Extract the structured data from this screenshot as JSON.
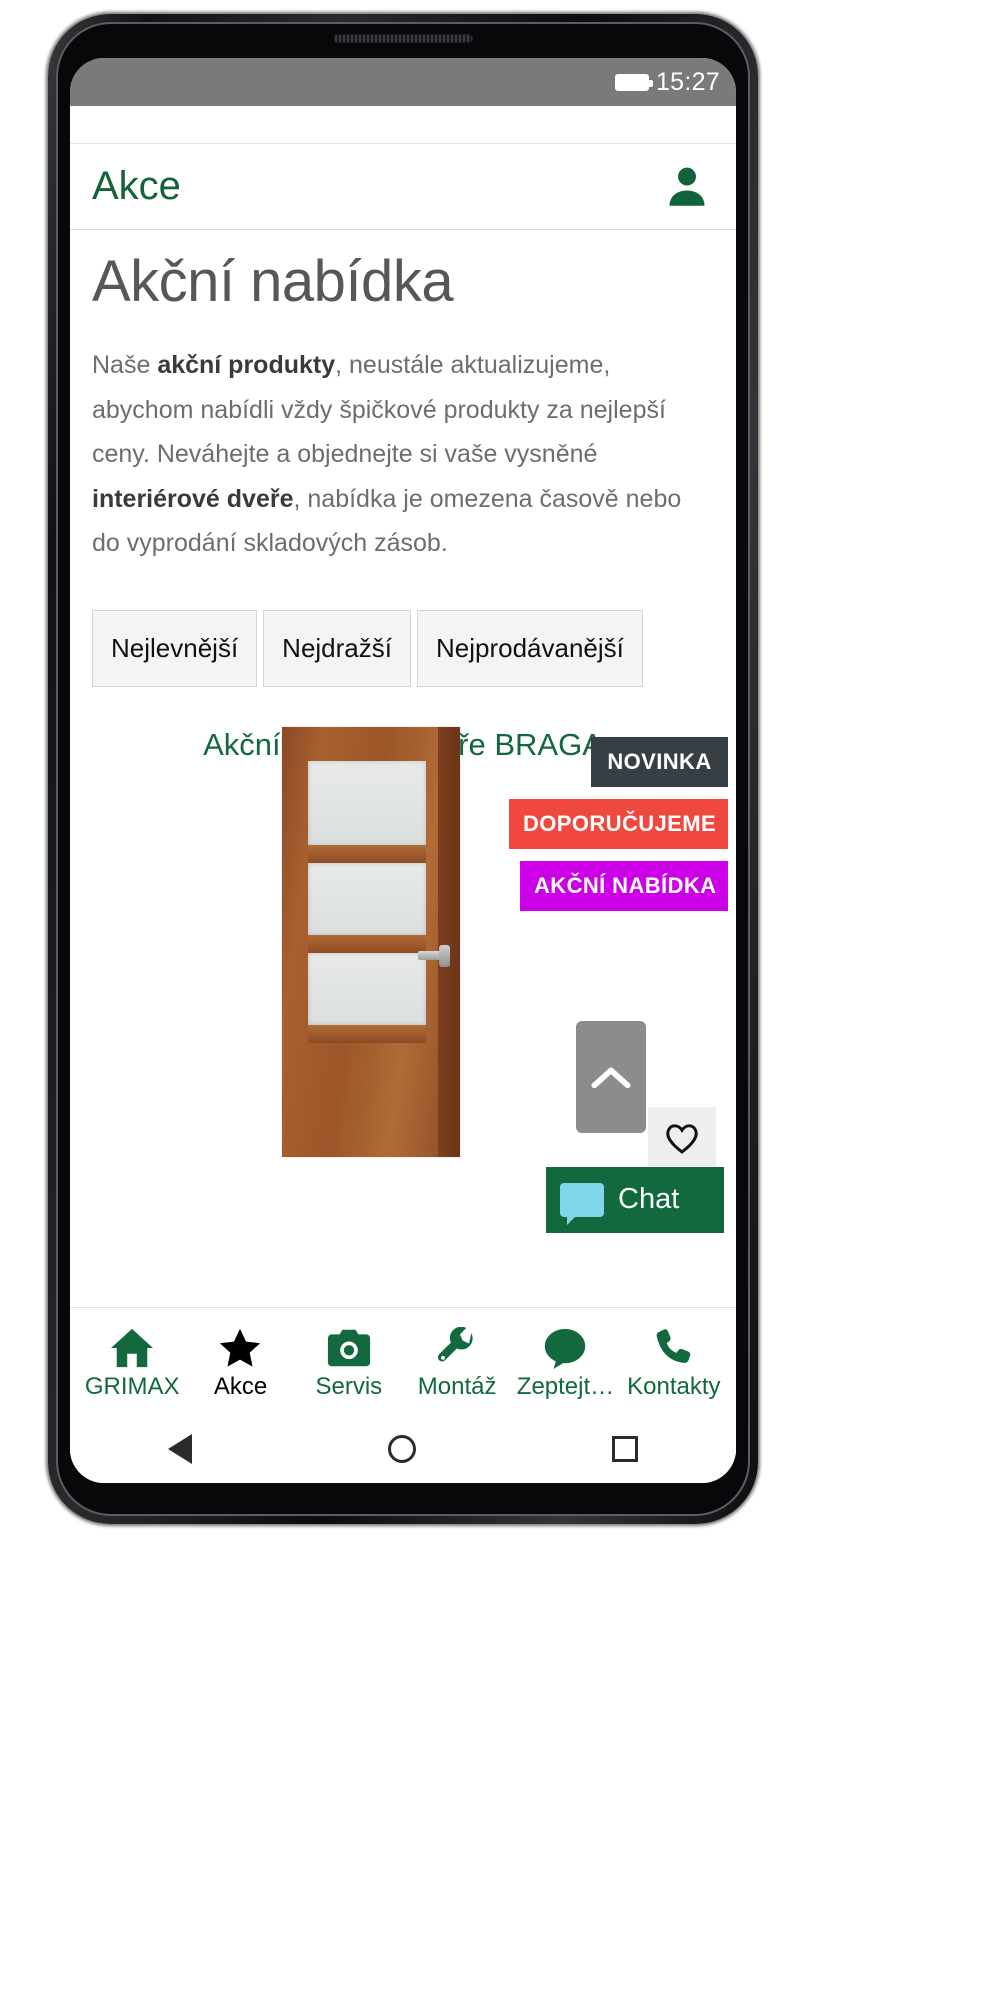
{
  "status_bar": {
    "time": "15:27",
    "battery_icon": "battery-icon"
  },
  "header": {
    "title": "Akce",
    "account_icon": "account-person-icon"
  },
  "page": {
    "title": "Akční nabídka",
    "paragraph": {
      "part1": "Naše ",
      "bold1": "akční produkty",
      "part2": ", neustále aktualizujeme, abychom nabídli vždy špičkové produkty za nejlepší ceny. Neváhejte a objednejte si vaše vysněné ",
      "bold2": "interiérové dveře",
      "part3": ", nabídka je omezena časově nebo do vyprodání skladových zásob."
    }
  },
  "filters": [
    {
      "label": "Nejlevnější"
    },
    {
      "label": "Nejdražší"
    },
    {
      "label": "Nejprodávanější"
    }
  ],
  "product": {
    "title": "Akční nabídka dveře BRAGA",
    "image_alt": "wooden-interior-door",
    "badges": [
      {
        "label": "NOVINKA",
        "color": "#373f45"
      },
      {
        "label": "DOPORUČUJEME",
        "color": "#f0483e"
      },
      {
        "label": "AKČNÍ NABÍDKA",
        "color": "#cc00e6"
      }
    ]
  },
  "widgets": {
    "scroll_top_icon": "chevron-up-icon",
    "favourite_icon": "heart-outline-icon",
    "chat_label": "Chat",
    "chat_icon": "chat-bubble-icon"
  },
  "bottom_nav": [
    {
      "label": "GRIMAX",
      "icon": "home-icon",
      "active": false
    },
    {
      "label": "Akce",
      "icon": "star-icon",
      "active": true
    },
    {
      "label": "Servis",
      "icon": "camera-icon",
      "active": false
    },
    {
      "label": "Montáž",
      "icon": "wrench-icon",
      "active": false
    },
    {
      "label": "Zeptejt…",
      "icon": "speech-bubble-icon",
      "active": false
    },
    {
      "label": "Kontakty",
      "icon": "phone-icon",
      "active": false
    }
  ],
  "system_nav": {
    "back": "back-triangle-icon",
    "home": "home-circle-icon",
    "recents": "recents-square-icon"
  },
  "colors": {
    "brand_green": "#12693d",
    "status_bar": "#7a7a7a",
    "badge_new": "#373f45",
    "badge_recommended": "#f0483e",
    "badge_promo": "#cc00e6"
  }
}
